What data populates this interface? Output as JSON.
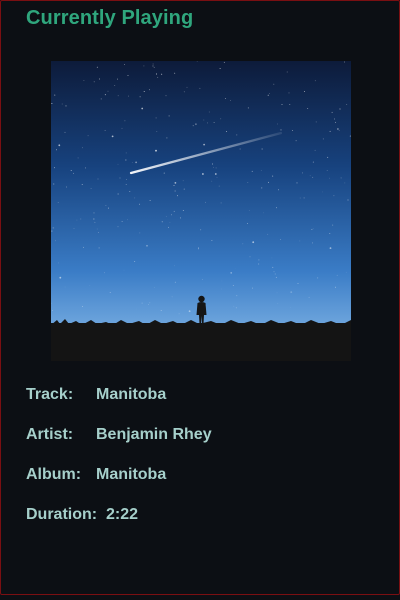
{
  "header": {
    "title": "Currently Playing"
  },
  "album_art": {
    "description_icon": "night-sky-shooting-star-image"
  },
  "track_info": {
    "track_label": "Track:",
    "track_value": "Manitoba",
    "artist_label": "Artist:",
    "artist_value": "Benjamin Rhey",
    "album_label": "Album:",
    "album_value": "Manitoba",
    "duration_label": "Duration:",
    "duration_value": "2:22"
  },
  "colors": {
    "background": "#0c0f14",
    "title": "#2fa67d",
    "text": "#a6d0cb",
    "border": "#7a0f12"
  }
}
